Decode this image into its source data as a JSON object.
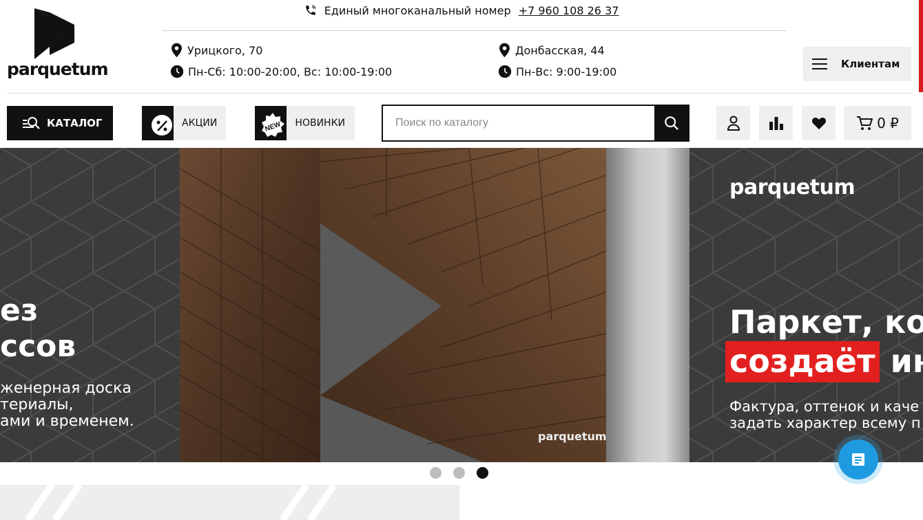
{
  "brand": {
    "name": "parquetum"
  },
  "header": {
    "phone_label": "Единый многоканальный номер",
    "phone_number": "+7 960 108 26 37",
    "stores": [
      {
        "address": "Урицкого, 70",
        "hours": "Пн-Сб: 10:00-20:00, Вс: 10:00-19:00"
      },
      {
        "address": "Донбасская, 44",
        "hours": "Пн-Вс: 9:00-19:00"
      }
    ],
    "clients_label": "Клиентам"
  },
  "toolbar": {
    "catalog_label": "КАТАЛОГ",
    "promo_label": "АКЦИИ",
    "new_label": "НОВИНКИ",
    "new_badge": "NEW",
    "search_placeholder": "Поиск по каталогу",
    "cart_total": "0 ₽"
  },
  "banner": {
    "prev_slide": {
      "line1": "ез",
      "line2": "ссов",
      "sub1": "женерная доска",
      "sub2": "териалы,",
      "sub3": "ами и временем."
    },
    "watermark": "parquetum",
    "logo": "parquetum",
    "headline_line1": "Паркет, кот",
    "headline_highlight": "создаёт",
    "headline_rest": " ин",
    "desc1": "Фактура, оттенок и каче",
    "desc2": "задать характер всему п"
  },
  "slider": {
    "total": 3,
    "active": 3
  },
  "colors": {
    "accent_red": "#e2201f",
    "chat_blue": "#1e9be0",
    "dark": "#111111"
  }
}
